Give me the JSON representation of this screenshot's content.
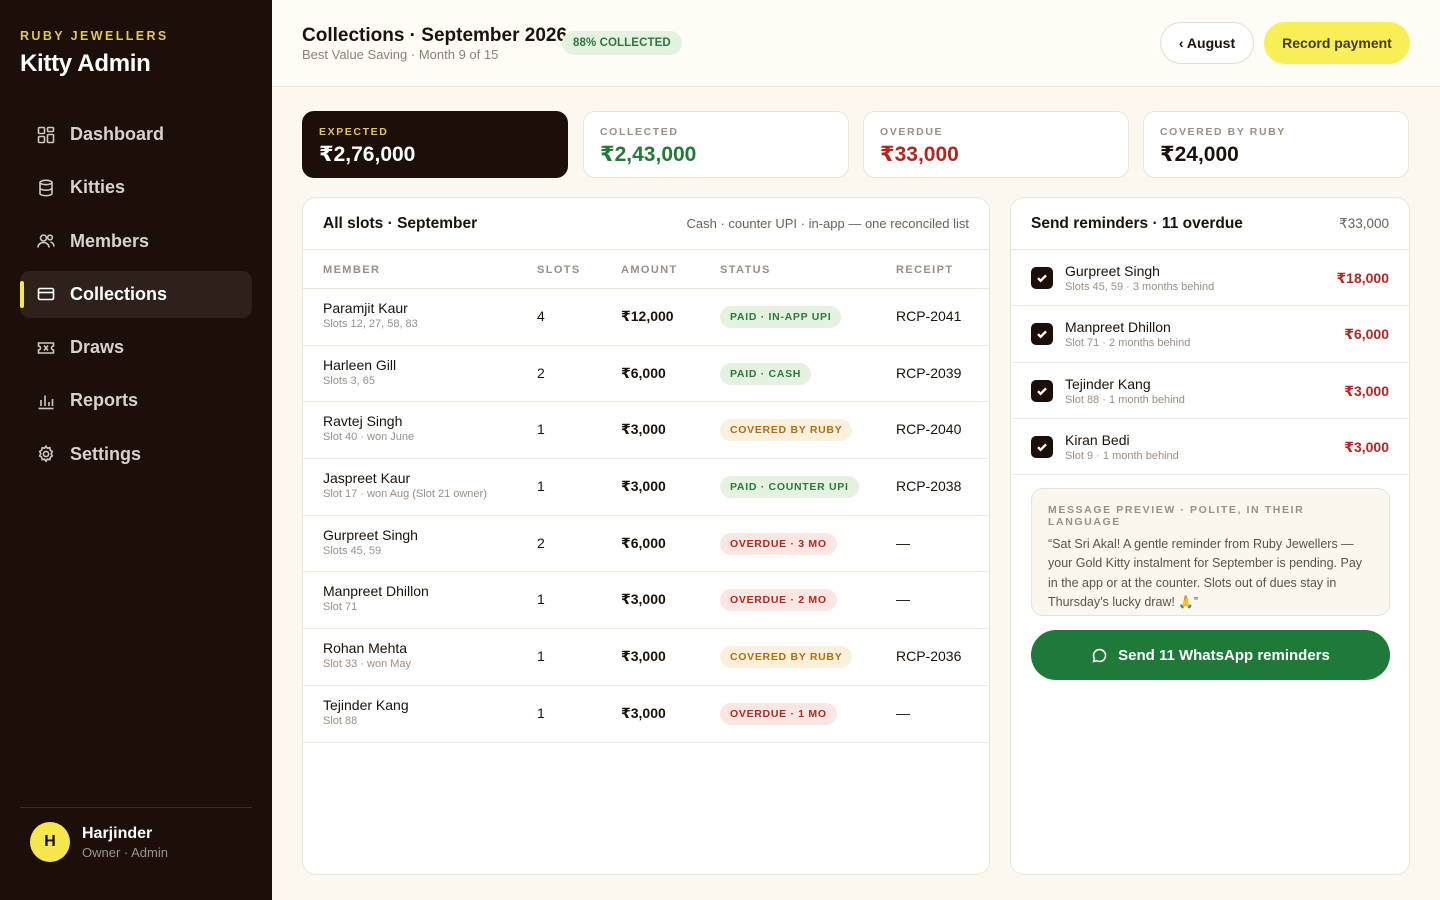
{
  "sidebar": {
    "brand_small": "RUBY JEWELLERS",
    "brand_title": "Kitty Admin",
    "items": [
      {
        "label": "Dashboard",
        "icon": "dashboard-icon"
      },
      {
        "label": "Kitties",
        "icon": "database-icon"
      },
      {
        "label": "Members",
        "icon": "members-icon"
      },
      {
        "label": "Collections",
        "icon": "card-icon",
        "active": true
      },
      {
        "label": "Draws",
        "icon": "ticket-icon"
      },
      {
        "label": "Reports",
        "icon": "bar-chart-icon"
      },
      {
        "label": "Settings",
        "icon": "gear-icon"
      }
    ],
    "user": {
      "initial": "H",
      "name": "Harjinder",
      "role": "Owner · Admin"
    }
  },
  "header": {
    "title": "Collections · September 2026",
    "subtitle": "Best Value Saving · Month 9 of 15",
    "badge": "88% COLLECTED",
    "prev_button": "‹ August",
    "primary_button": "Record payment"
  },
  "stats": [
    {
      "label": "EXPECTED",
      "value": "₹2,76,000"
    },
    {
      "label": "COLLECTED",
      "value": "₹2,43,000"
    },
    {
      "label": "OVERDUE",
      "value": "₹33,000"
    },
    {
      "label": "COVERED BY RUBY",
      "value": "₹24,000"
    }
  ],
  "slots": {
    "title": "All slots · September",
    "note": "Cash · counter UPI · in-app — one reconciled list",
    "columns": [
      "MEMBER",
      "SLOTS",
      "AMOUNT",
      "STATUS",
      "RECEIPT"
    ],
    "rows": [
      {
        "name": "Paramjit Kaur",
        "sub": "Slots 12, 27, 58, 83",
        "slots": "4",
        "amount": "₹12,000",
        "status": "PAID · IN-APP UPI",
        "kind": "paid",
        "receipt": "RCP-2041"
      },
      {
        "name": "Harleen Gill",
        "sub": "Slots 3, 65",
        "slots": "2",
        "amount": "₹6,000",
        "status": "PAID · CASH",
        "kind": "paid",
        "receipt": "RCP-2039"
      },
      {
        "name": "Ravtej Singh",
        "sub": "Slot 40 · won June",
        "slots": "1",
        "amount": "₹3,000",
        "status": "COVERED BY RUBY",
        "kind": "ruby",
        "receipt": "RCP-2040"
      },
      {
        "name": "Jaspreet Kaur",
        "sub": "Slot 17 · won Aug (Slot 21 owner)",
        "slots": "1",
        "amount": "₹3,000",
        "status": "PAID · COUNTER UPI",
        "kind": "paid",
        "receipt": "RCP-2038"
      },
      {
        "name": "Gurpreet Singh",
        "sub": "Slots 45, 59",
        "slots": "2",
        "amount": "₹6,000",
        "status": "OVERDUE · 3 MO",
        "kind": "overdue",
        "receipt": "—"
      },
      {
        "name": "Manpreet Dhillon",
        "sub": "Slot 71",
        "slots": "1",
        "amount": "₹3,000",
        "status": "OVERDUE · 2 MO",
        "kind": "overdue",
        "receipt": "—"
      },
      {
        "name": "Rohan Mehta",
        "sub": "Slot 33 · won May",
        "slots": "1",
        "amount": "₹3,000",
        "status": "COVERED BY RUBY",
        "kind": "ruby",
        "receipt": "RCP-2036"
      },
      {
        "name": "Tejinder Kang",
        "sub": "Slot 88",
        "slots": "1",
        "amount": "₹3,000",
        "status": "OVERDUE · 1 MO",
        "kind": "overdue",
        "receipt": "—"
      }
    ]
  },
  "reminders": {
    "title": "Send reminders · 11 overdue",
    "total": "₹33,000",
    "items": [
      {
        "name": "Gurpreet Singh",
        "sub": "Slots 45, 59 · 3 months behind",
        "amount": "₹18,000",
        "checked": true
      },
      {
        "name": "Manpreet Dhillon",
        "sub": "Slot 71 · 2 months behind",
        "amount": "₹6,000",
        "checked": true
      },
      {
        "name": "Tejinder Kang",
        "sub": "Slot 88 · 1 month behind",
        "amount": "₹3,000",
        "checked": true
      },
      {
        "name": "Kiran Bedi",
        "sub": "Slot 9 · 1 month behind",
        "amount": "₹3,000",
        "checked": true
      }
    ],
    "preview_label": "MESSAGE PREVIEW · POLITE, IN THEIR LANGUAGE",
    "preview_text": "“Sat Sri Akal! A gentle reminder from Ruby Jewellers — your Gold Kitty instalment for September is pending. Pay in the app or at the counter. Slots out of dues stay in Thursday’s lucky draw! 🙏”",
    "send_button": "Send 11 WhatsApp reminders"
  },
  "colors": {
    "sidebar_bg": "#1c0e09",
    "accent_yellow": "#f8ee56",
    "brand_gold": "#e6c64a",
    "green": "#237a35",
    "red": "#b5261e",
    "whatsapp_green": "#1f7a3a"
  }
}
